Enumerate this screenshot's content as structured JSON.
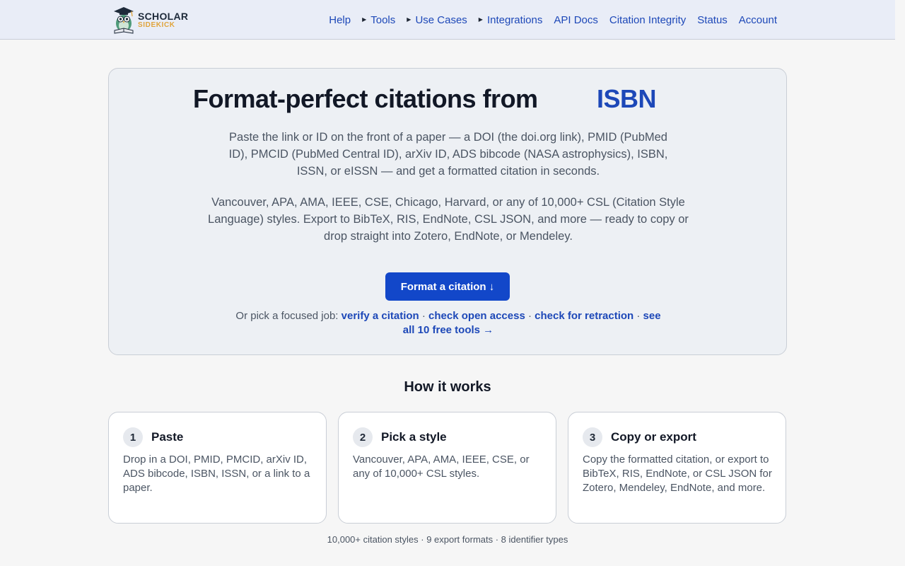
{
  "brand": {
    "logo_top": "SCHOLAR",
    "logo_bottom": "SIDEKICK",
    "logo_icon": "owl-graduate-icon",
    "accent_color": "#1d48b8",
    "logo_secondary_color": "#e0a43c"
  },
  "nav": {
    "help": "Help",
    "tools": "Tools",
    "use_cases": "Use Cases",
    "integrations": "Integrations",
    "api_docs": "API Docs",
    "citation_integrity": "Citation Integrity",
    "status": "Status",
    "account": "Account",
    "caret_icon": "caret-right-icon"
  },
  "hero": {
    "title_prefix": "Format-perfect citations from",
    "title_rotating": "ISBN",
    "lead": "Paste the link or ID on the front of a paper — a DOI (the doi.org link), PMID (PubMed ID), PMCID (PubMed Central ID), arXiv ID, ADS bibcode (NASA astrophysics), ISBN, ISSN, or eISSN — and get a formatted citation in seconds.",
    "lead2": "Vancouver, APA, AMA, IEEE, CSE, Chicago, Harvard, or any of 10,000+ CSL (Citation Style Language) styles. Export to BibTeX, RIS, EndNote, CSL JSON, and more — ready to copy or drop straight into Zotero, EndNote, or Mendeley.",
    "cta": "Format a citation ↓",
    "cta_color": "#1247c9",
    "jobs_prefix": "Or pick a focused job:",
    "job_verify": "verify a citation",
    "job_open_access": "check open access",
    "job_retraction": "check for retraction",
    "job_all": "see all 10 free tools →",
    "separator": "·"
  },
  "how": {
    "heading": "How it works",
    "steps": [
      {
        "num": "1",
        "title": "Paste",
        "body": "Drop in a DOI, PMID, PMCID, arXiv ID, ADS bibcode, ISBN, ISSN, or a link to a paper."
      },
      {
        "num": "2",
        "title": "Pick a style",
        "body": "Vancouver, APA, AMA, IEEE, CSE, or any of 10,000+ CSL styles."
      },
      {
        "num": "3",
        "title": "Copy or export",
        "body": "Copy the formatted citation, or export to BibTeX, RIS, EndNote, or CSL JSON for Zotero, Mendeley, EndNote, and more."
      }
    ]
  },
  "stats": "10,000+ citation styles · 9 export formats · 8 identifier types"
}
